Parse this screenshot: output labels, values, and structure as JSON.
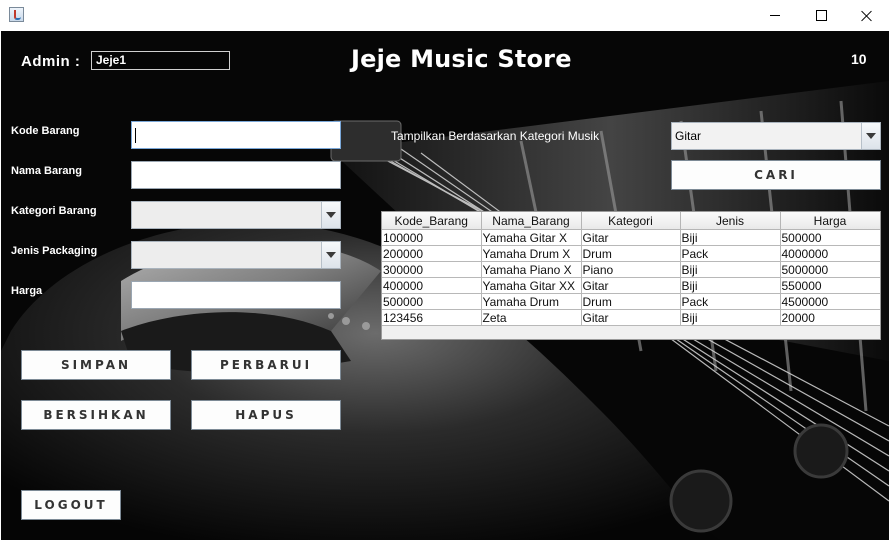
{
  "window": {
    "icon": "java-icon"
  },
  "header": {
    "admin_label": "Admin :",
    "admin_value": "Jeje1",
    "title": "Jeje Music Store",
    "counter": "10"
  },
  "form": {
    "kode_barang_label": "Kode Barang",
    "nama_barang_label": "Nama Barang",
    "kategori_barang_label": "Kategori Barang",
    "jenis_packaging_label": "Jenis Packaging",
    "harga_label": "Harga",
    "kode_barang_value": "",
    "nama_barang_value": "",
    "kategori_barang_value": "",
    "jenis_packaging_value": "",
    "harga_value": ""
  },
  "filter": {
    "label": "Tampilkan Berdasarkan Kategori Musik",
    "selected": "Gitar"
  },
  "buttons": {
    "cari": "CARI",
    "simpan": "SIMPAN",
    "perbarui": "PERBARUI",
    "bersihkan": "BERSIHKAN",
    "hapus": "HAPUS",
    "logout": "LOGOUT"
  },
  "table": {
    "columns": [
      "Kode_Barang",
      "Nama_Barang",
      "Kategori",
      "Jenis",
      "Harga"
    ],
    "rows": [
      [
        "100000",
        "Yamaha Gitar X",
        "Gitar",
        "Biji",
        "500000"
      ],
      [
        "200000",
        "Yamaha Drum X",
        "Drum",
        "Pack",
        "4000000"
      ],
      [
        "300000",
        "Yamaha Piano X",
        "Piano",
        "Biji",
        "5000000"
      ],
      [
        "400000",
        "Yamaha Gitar XX",
        "Gitar",
        "Biji",
        "550000"
      ],
      [
        "500000",
        "Yamaha Drum",
        "Drum",
        "Pack",
        "4500000"
      ],
      [
        "123456",
        "Zeta",
        "Gitar",
        "Biji",
        "20000"
      ]
    ]
  }
}
